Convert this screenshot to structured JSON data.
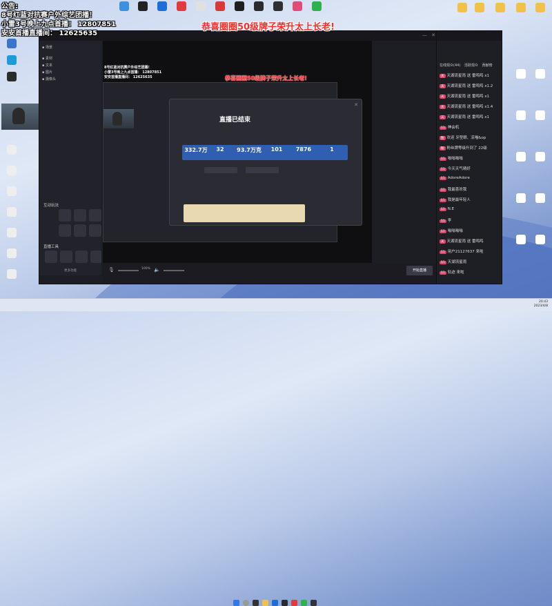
{
  "announcement": {
    "line1": "公告:",
    "line2": "8号红蓝对抗赛户外综艺团播！",
    "line3": "小雷3号晚上九点首播： 12807851",
    "line4": "安安首播直播间：  12625635"
  },
  "banner": {
    "congrats": "恭喜圈圈50级牌子荣升太上长老!"
  },
  "ended_dialog": {
    "title": "直播已结束",
    "stats": [
      {
        "value": "332.7万"
      },
      {
        "value": "32"
      },
      {
        "value": "93.7万克"
      },
      {
        "value": "101"
      },
      {
        "value": "7876"
      },
      {
        "value": "1"
      }
    ]
  },
  "studio": {
    "app_name": "直播伴侣",
    "section_interact": "互动玩法",
    "section_tools": "直播工具",
    "start_button": "开始直播",
    "zoom": "100%",
    "more": "更多功能"
  },
  "chat": {
    "header": "在线观众(44)",
    "tab_fans": "活跃观众",
    "tab_rank": "贡献榜",
    "messages": [
      {
        "level": "天",
        "text": "天湖流星雨 送 雷鸣鸣 x1"
      },
      {
        "level": "天",
        "text": "天湖流星雨 送 雷鸣鸣 x1.2"
      },
      {
        "level": "天",
        "text": "天湖流星雨 送 雷鸣鸣 x1"
      },
      {
        "level": "天",
        "text": "天湖流星雨 送 雷鸣鸣 x1.4"
      },
      {
        "level": "天",
        "text": "天湖流星雨 送 雷鸣鸣 x1"
      },
      {
        "level": "11",
        "text": "神会机"
      },
      {
        "level": "粉",
        "text": "欢迎 牙型眼、凉喵&op"
      },
      {
        "level": "粉",
        "text": "粉丝牌等级升到了 22级"
      },
      {
        "level": "11",
        "text": "嗡嗡嗡嗡"
      },
      {
        "level": "11",
        "text": "今天天气晴好"
      },
      {
        "level": "11",
        "text": "AdoreAdore"
      },
      {
        "level": "11",
        "text": "我最喜欢我"
      },
      {
        "level": "11",
        "text": "我是最年轻人"
      },
      {
        "level": "11",
        "text": "N.E"
      },
      {
        "level": "11",
        "text": "李"
      },
      {
        "level": "11",
        "text": "嗡嗡嗡嗡"
      },
      {
        "level": "天",
        "text": "天湖流星雨 送 雷鸣鸣"
      },
      {
        "level": "11",
        "text": "用户21127637 来啦"
      },
      {
        "level": "11",
        "text": "天湖流星雨"
      },
      {
        "level": "11",
        "text": "轨迹 来啦"
      }
    ]
  },
  "taskbar": {
    "time": "20:43",
    "date": "2023/4/8"
  },
  "colors": {
    "accent": "#e0466a",
    "start_button": "#3a3a46"
  }
}
